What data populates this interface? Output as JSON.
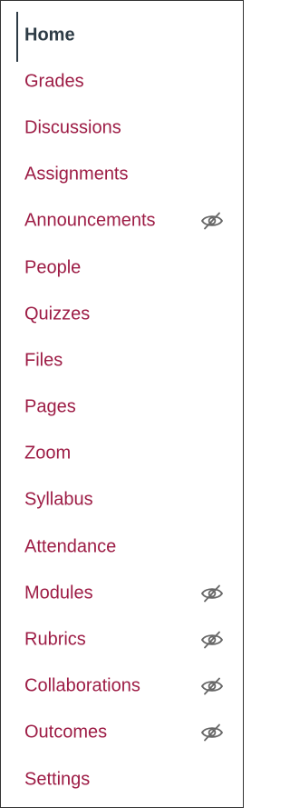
{
  "nav": {
    "items": [
      {
        "label": "Home",
        "active": true,
        "hidden_from_students": false,
        "icon": ""
      },
      {
        "label": "Grades",
        "active": false,
        "hidden_from_students": false,
        "icon": ""
      },
      {
        "label": "Discussions",
        "active": false,
        "hidden_from_students": false,
        "icon": ""
      },
      {
        "label": "Assignments",
        "active": false,
        "hidden_from_students": false,
        "icon": ""
      },
      {
        "label": "Announcements",
        "active": false,
        "hidden_from_students": true,
        "icon": "eye-slash-icon"
      },
      {
        "label": "People",
        "active": false,
        "hidden_from_students": false,
        "icon": ""
      },
      {
        "label": "Quizzes",
        "active": false,
        "hidden_from_students": false,
        "icon": ""
      },
      {
        "label": "Files",
        "active": false,
        "hidden_from_students": false,
        "icon": ""
      },
      {
        "label": "Pages",
        "active": false,
        "hidden_from_students": false,
        "icon": ""
      },
      {
        "label": "Zoom",
        "active": false,
        "hidden_from_students": false,
        "icon": ""
      },
      {
        "label": "Syllabus",
        "active": false,
        "hidden_from_students": false,
        "icon": ""
      },
      {
        "label": "Attendance",
        "active": false,
        "hidden_from_students": false,
        "icon": ""
      },
      {
        "label": "Modules",
        "active": false,
        "hidden_from_students": true,
        "icon": "eye-slash-icon"
      },
      {
        "label": "Rubrics",
        "active": false,
        "hidden_from_students": true,
        "icon": "eye-slash-icon"
      },
      {
        "label": "Collaborations",
        "active": false,
        "hidden_from_students": true,
        "icon": "eye-slash-icon"
      },
      {
        "label": "Outcomes",
        "active": false,
        "hidden_from_students": true,
        "icon": "eye-slash-icon"
      },
      {
        "label": "Settings",
        "active": false,
        "hidden_from_students": false,
        "icon": ""
      }
    ]
  },
  "colors": {
    "link": "#9d1c45",
    "active_text": "#2d3b45",
    "active_indicator": "#2d3b45",
    "icon": "#666666",
    "border": "#333333"
  }
}
